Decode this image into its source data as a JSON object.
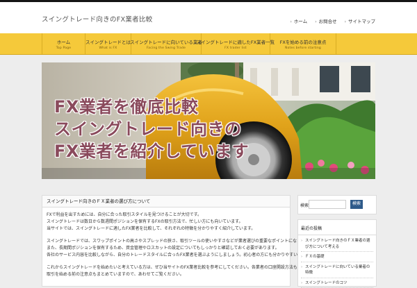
{
  "site": {
    "title": "スイングトレード向きのFX業者比較"
  },
  "top_links": [
    {
      "label": "ホーム"
    },
    {
      "label": "お問合せ"
    },
    {
      "label": "サイトマップ"
    }
  ],
  "nav": [
    {
      "jp": "ホーム",
      "en": "Top Page"
    },
    {
      "jp": "スイングトレードとは",
      "en": "What is FX"
    },
    {
      "jp": "スイングトレードに向いている業者",
      "en": "Facing the Swing Trade"
    },
    {
      "jp": "スイングトレードに適したFX業者一覧",
      "en": "FX trader list"
    },
    {
      "jp": "FXを始める前の注意点",
      "en": "Notes before starting"
    }
  ],
  "banner": {
    "lines": [
      "FX業者を徹底比較",
      "スイングトレード向きの",
      "FX業者を紹介しています"
    ]
  },
  "main": {
    "heading": "スイングトレード向きのＦＸ業者の選び方について",
    "paragraphs": [
      [
        "FXで利益を出すためには、自分に合った取引スタイルを見つけることが大切です。",
        "スイングトレードは数日から数週間ポジションを保有するFXの取引方法で、忙しい方にも向いています。",
        "当サイトでは、スイングトレードに適したFX業者を比較して、それぞれの特徴を分かりやすく紹介しています。"
      ],
      [
        "スイングトレードでは、スワップポイントの高さやスプレッドの狭さ、取引ツールの使いやすさなどが業者選びの重要なポイントになります。",
        "また、長期間ポジションを保有するため、資金管理やロスカットの設定についてもしっかりと確認しておく必要があります。",
        "各社のサービス内容を比較しながら、自分のトレードスタイルに合ったFX業者を選ぶようにしましょう。初心者の方にも分かりやすい情報をまとめています。"
      ],
      [
        "これからスイングトレードを始めたいと考えている方は、ぜひ当サイトのFX業者比較を参考にしてください。各業者の口座開設方法も紹介しています。",
        "取引を始める前の注意点もまとめていますので、あわせてご覧ください。"
      ]
    ]
  },
  "sidebar": {
    "search_label": "検索:",
    "search_placeholder": "",
    "search_button": "検索",
    "box_title": "最近の投稿",
    "items": [
      "スイングトレード向きのＦＸ業者の選び方について考える",
      "ＦＸの基礎",
      "スイングトレードに向いている業者の特徴",
      "スイングトレードのコツ"
    ]
  },
  "colors": {
    "nav_bg": "#f5c93a",
    "banner_text": "#8a4a5c",
    "button": "#2e5a8a"
  }
}
